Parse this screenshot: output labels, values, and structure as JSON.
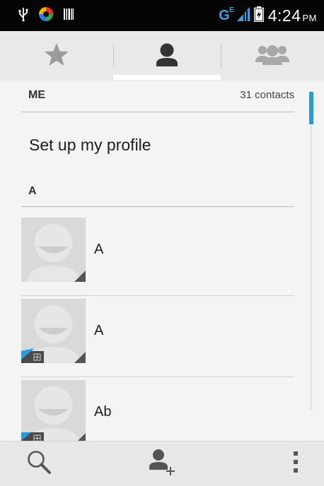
{
  "status_bar": {
    "network": "G",
    "network_sup": "E",
    "time": "4:24",
    "ampm": "PM"
  },
  "tabs": [
    {
      "name": "favorites",
      "icon": "star-icon",
      "selected": false
    },
    {
      "name": "contacts",
      "icon": "person-icon",
      "selected": true
    },
    {
      "name": "groups",
      "icon": "group-icon",
      "selected": false
    }
  ],
  "list": {
    "me_header": "ME",
    "contact_count": "31 contacts",
    "setup_profile": "Set up my profile",
    "section_a": "A",
    "contacts": [
      {
        "name": "A",
        "sim_badge": false
      },
      {
        "name": "A",
        "sim_badge": true
      },
      {
        "name": "Ab",
        "sim_badge": true
      }
    ]
  },
  "bottom_bar": {
    "search_icon": "search-icon",
    "add_contact_icon": "add-contact-icon",
    "menu_icon": "overflow-menu-icon"
  },
  "colors": {
    "accent": "#2a9bd8",
    "status_bar": "#050505",
    "tab_bar": "#e9e9e9"
  }
}
